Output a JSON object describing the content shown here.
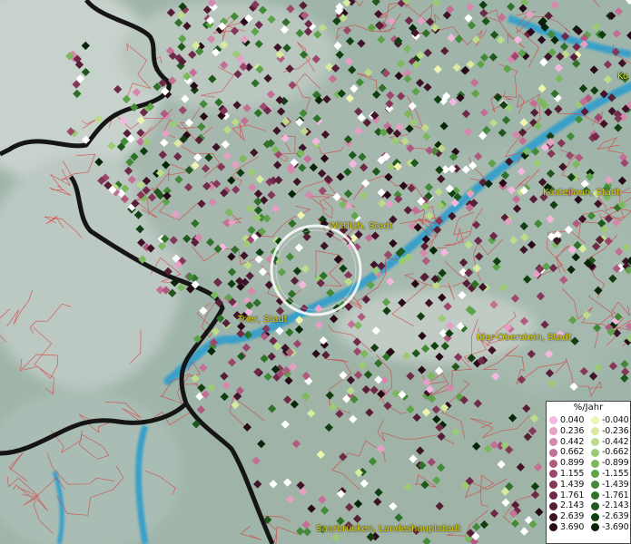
{
  "cities": [
    {
      "id": "wittlich",
      "name": "Wittlich, Stadt"
    },
    {
      "id": "trier",
      "name": "Trier, Stadt"
    },
    {
      "id": "kastellaun",
      "name": "Kastellaun, Stadt"
    },
    {
      "id": "idar",
      "name": "Idar-Oberstein, Stadt"
    },
    {
      "id": "saarbruecken",
      "name": "Saarbrücken, Landeshauptstadt"
    },
    {
      "id": "koblenz",
      "name": "Ko"
    }
  ],
  "legend": {
    "title": "%/Jahr",
    "positive": [
      {
        "label": "0.040",
        "color": "#f4b8e0"
      },
      {
        "label": "0.236",
        "color": "#e6a0c6"
      },
      {
        "label": "0.442",
        "color": "#d687ad"
      },
      {
        "label": "0.662",
        "color": "#c47096"
      },
      {
        "label": "0.899",
        "color": "#b05a80"
      },
      {
        "label": "1.155",
        "color": "#9b486c"
      },
      {
        "label": "1.439",
        "color": "#85375a"
      },
      {
        "label": "1.761",
        "color": "#6e2a48"
      },
      {
        "label": "2.143",
        "color": "#571e37"
      },
      {
        "label": "2.639",
        "color": "#401428"
      },
      {
        "label": "3.690",
        "color": "#280a18"
      }
    ],
    "negative": [
      {
        "label": "-0.040",
        "color": "#eef5b0"
      },
      {
        "label": "-0.236",
        "color": "#d8ec9e"
      },
      {
        "label": "-0.442",
        "color": "#bcdc8a"
      },
      {
        "label": "-0.662",
        "color": "#9ccb74"
      },
      {
        "label": "-0.899",
        "color": "#7cb85e"
      },
      {
        "label": "-1.155",
        "color": "#5ea24a"
      },
      {
        "label": "-1.439",
        "color": "#438a38"
      },
      {
        "label": "-1.761",
        "color": "#2f7129"
      },
      {
        "label": "-2.143",
        "color": "#1f581c"
      },
      {
        "label": "-2.639",
        "color": "#123f11"
      },
      {
        "label": "-3.690",
        "color": "#072607"
      }
    ]
  }
}
